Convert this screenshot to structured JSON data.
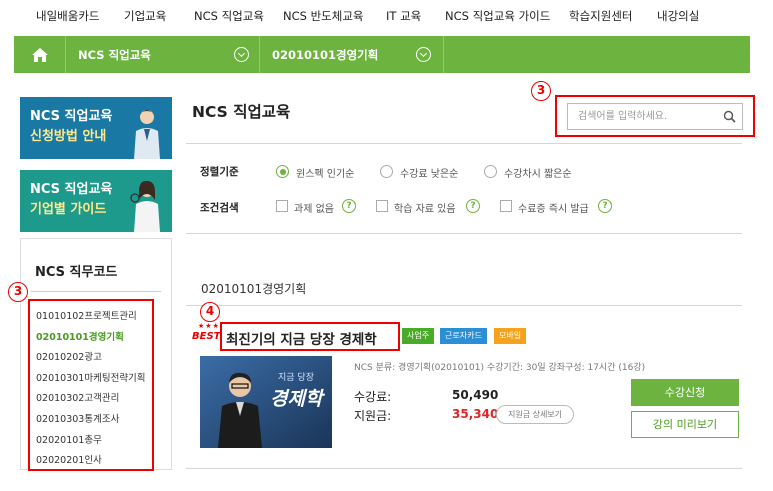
{
  "top_nav": [
    "내일배움카드",
    "기업교육",
    "NCS 직업교육",
    "NCS 반도체교육",
    "IT 교육",
    "NCS 직업교육 가이드",
    "학습지원센터",
    "내강의실"
  ],
  "breadcrumb": {
    "level1": "NCS 직업교육",
    "level2": "02010101경영기획"
  },
  "banners": [
    {
      "line1": "NCS 직업교육",
      "line2": "신청방법 안내"
    },
    {
      "line1": "NCS 직업교육",
      "line2": "기업별 가이드"
    }
  ],
  "job_code": {
    "title": "NCS 직무코드",
    "items": [
      "01010102프로젝트관리",
      "02010101경영기획",
      "02010202광고",
      "02010301마케팅전략기획",
      "02010302고객관리",
      "02010303통계조사",
      "02020101총무",
      "02020201인사"
    ]
  },
  "main_title": "NCS 직업교육",
  "search": {
    "placeholder": "검색어를 입력하세요."
  },
  "sort": {
    "label": "정렬기준",
    "options": [
      "윈스펙 인기순",
      "수강료 낮은순",
      "수강차시 짧은순"
    ]
  },
  "filter": {
    "label": "조건검색",
    "options": [
      "과제 없음",
      "학습 자료 있음",
      "수료증 즉시 발급"
    ],
    "help": "?"
  },
  "annotations": [
    "3",
    "3",
    "4"
  ],
  "category_title": "02010101경영기획",
  "course": {
    "best_stars": "★★★",
    "best": "BEST",
    "title": "최진기의 지금 당장 경제학",
    "tags": [
      {
        "label": "사업주",
        "color": "#4aab2a"
      },
      {
        "label": "근로자카드",
        "color": "#2c8fd6"
      },
      {
        "label": "모바일",
        "color": "#f5a31a"
      }
    ],
    "meta": "NCS 분류: 경영기획(02010101)   수강기간: 30일   강좌구성: 17시간 (16강)",
    "fee_label": "수강료:",
    "fee": "50,490",
    "support_label": "지원금:",
    "support": "35,340",
    "support_detail": "지원금 상세보기",
    "apply": "수강신청",
    "preview": "강의 미리보기",
    "thumb_title": "경제학",
    "thumb_sub": "지금 당장"
  }
}
